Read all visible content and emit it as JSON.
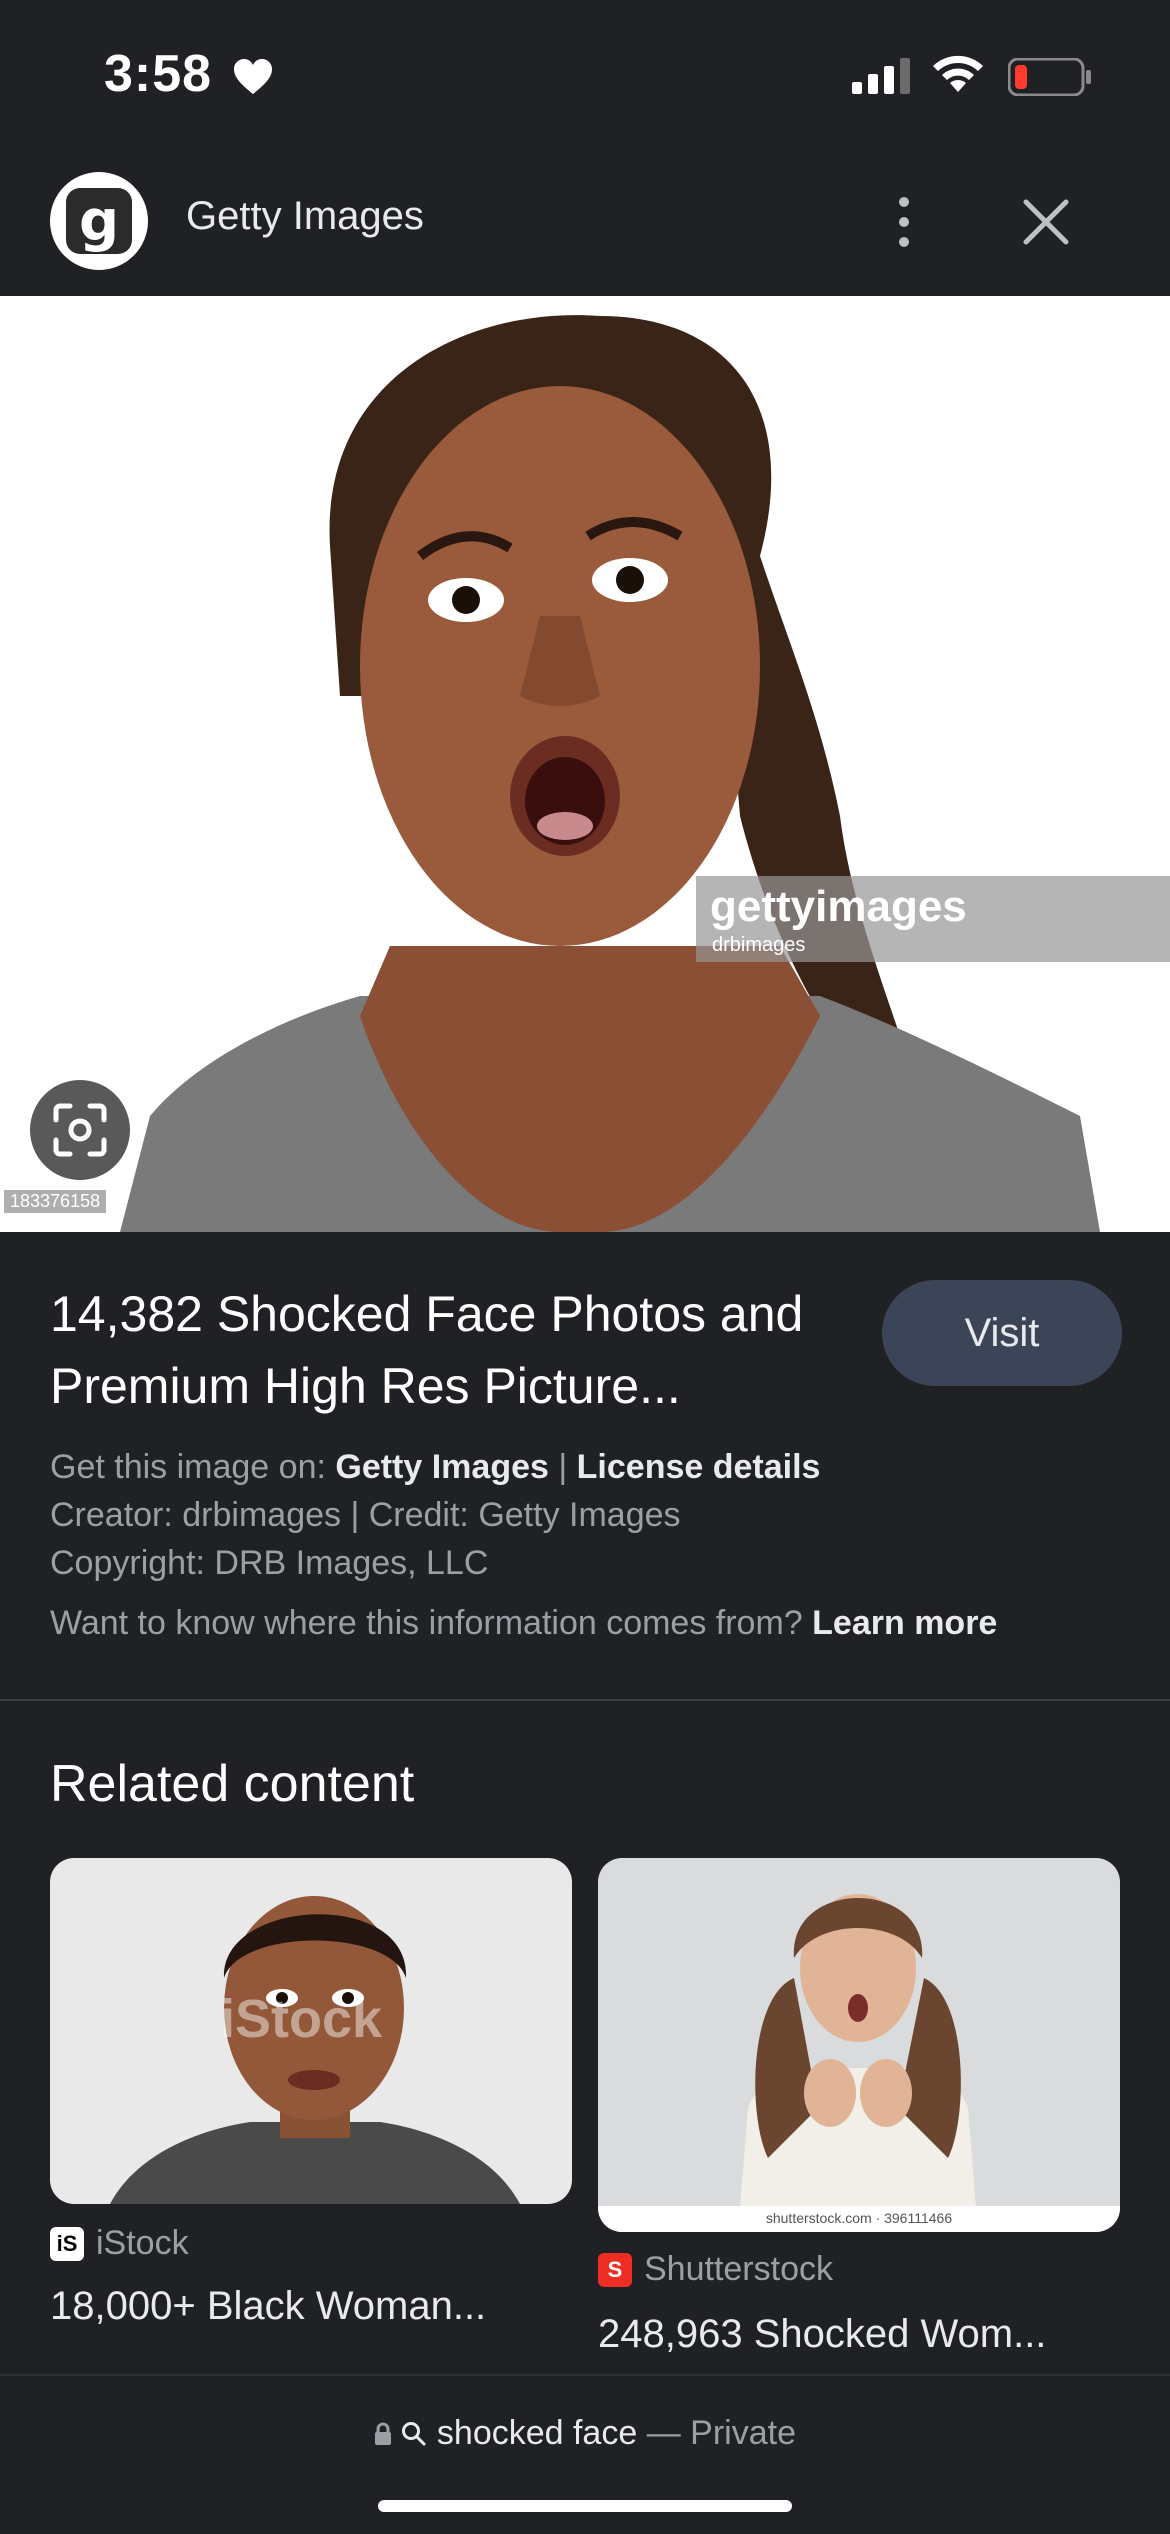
{
  "status": {
    "time": "3:58"
  },
  "header": {
    "site_name": "Getty Images",
    "logo_letter": "g"
  },
  "hero": {
    "watermark_brand": "gettyimages",
    "watermark_sub": "drbimages",
    "image_id": "183376158"
  },
  "info": {
    "title": "14,382 Shocked Face Photos and Premium High Res Picture...",
    "visit_label": "Visit",
    "get_prefix": "Get this image on:",
    "get_source": "Getty Images",
    "separator": "|",
    "license": "License details",
    "creator_line": "Creator: drbimages | Credit: Getty Images",
    "copyright_line": "Copyright: DRB Images, LLC",
    "question": "Want to know where this information comes from?",
    "learn_more": "Learn more"
  },
  "related": {
    "heading": "Related content",
    "items": [
      {
        "source": "iStock",
        "source_icon": "iS",
        "title": "18,000+ Black Woman...",
        "watermark": "iStock"
      },
      {
        "source": "Shutterstock",
        "source_icon": "S",
        "title": "248,963 Shocked Wom...",
        "watermark": "shutterstock.com · 396111466"
      }
    ]
  },
  "bottom": {
    "query": "shocked face",
    "mode": "— Private"
  },
  "colors": {
    "background": "#202124",
    "visit_button": "#3c4457",
    "shutterstock": "#ee2e24"
  }
}
